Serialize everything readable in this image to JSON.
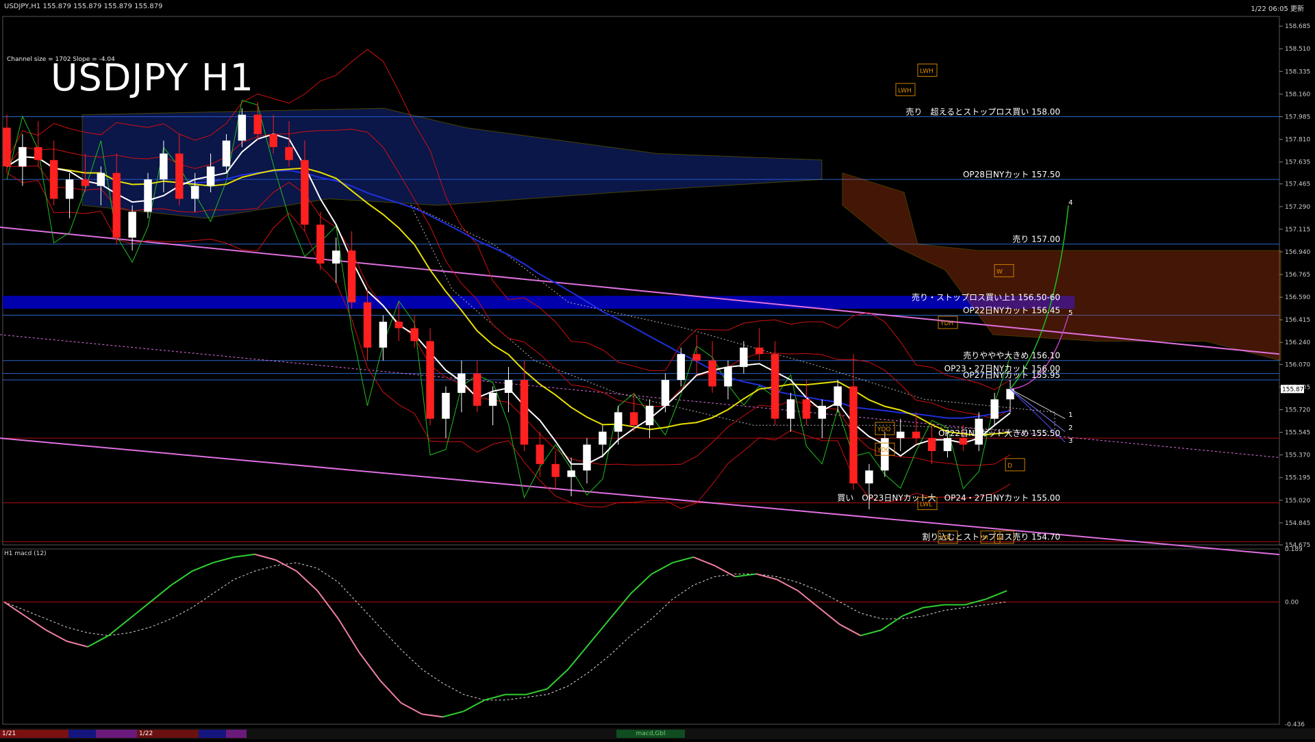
{
  "header": {
    "symbol_line": "USDJPY,H1 155.879 155.879 155.879 155.879",
    "datetime": "1/22 06:05 更新",
    "big_title": "USDJPY H1",
    "channel_info": "Channel size = 1702 Slope = -4.04",
    "macd_label": "H1 macd (12)"
  },
  "colors": {
    "background": "#000000",
    "grid_blue": "#2a66c8",
    "level_red": "#b01010",
    "band_blue": "#0000c0",
    "channel_pink": "#e070e0",
    "ma_white": "#ffffff",
    "ma_yellow": "#e8e000",
    "ma_blue": "#2030e0",
    "bollinger_red": "#d01010",
    "rsi_green": "#20c020",
    "cloud_orange": "#c04010",
    "cloud_blue": "#2040d0",
    "macd_green": "#30d030",
    "macd_pink": "#f080a0",
    "candle_up": "#ffffff",
    "candle_down": "#ff2020"
  },
  "chart_data": {
    "type": "candlestick",
    "symbol": "USDJPY",
    "timeframe": "H1",
    "current_price": "155.879",
    "ylim": [
      154.675,
      158.76
    ],
    "y_ticks": [
      "158.685",
      "158.510",
      "158.335",
      "158.160",
      "157.985",
      "157.810",
      "157.635",
      "157.465",
      "157.290",
      "157.115",
      "156.940",
      "156.765",
      "156.590",
      "156.415",
      "156.240",
      "156.070",
      "155.895",
      "155.720",
      "155.545",
      "155.370",
      "155.195",
      "155.020",
      "154.845",
      "154.675"
    ],
    "x_tick_labels": [
      "1/21",
      "1/22"
    ],
    "horizontal_levels": [
      {
        "price": 157.985,
        "label": "売り　超えるとストップロス買い 158.00",
        "color": "blue"
      },
      {
        "price": 157.5,
        "label": "OP28日NYカット 157.50",
        "color": "blue"
      },
      {
        "price": 157.0,
        "label": "売り 157.00",
        "color": "blue"
      },
      {
        "price": 156.55,
        "label": "売り・ストップロス買い上1 156.50-60",
        "color": "band"
      },
      {
        "price": 156.45,
        "label": "OP22日NYカット 156.45",
        "color": "blue"
      },
      {
        "price": 156.1,
        "label": "売りややや大きめ 156.10",
        "color": "blue"
      },
      {
        "price": 156.0,
        "label": "OP23・27日NYカット 156.00",
        "color": "blue"
      },
      {
        "price": 155.95,
        "label": "OP27日NYカット 155.95",
        "color": "blue"
      },
      {
        "price": 155.5,
        "label": "OP22日NYカット大きめ 155.50",
        "color": "red"
      },
      {
        "price": 155.0,
        "label": "買い　OP23日NYカット大　OP24・27日NYカット 155.00",
        "color": "red"
      },
      {
        "price": 154.7,
        "label": "割り込むとストップロス売り 154.70",
        "color": "red"
      }
    ],
    "box_labels": [
      "LWH",
      "LWH",
      "YDH",
      "W",
      "YDO",
      "YDC",
      "D",
      "LWL",
      "YDL",
      "M",
      "W"
    ],
    "projection_labels": [
      "1",
      "2",
      "3",
      "4",
      "5"
    ],
    "candles": [
      [
        157.9,
        158.0,
        157.55,
        157.6
      ],
      [
        157.6,
        157.85,
        157.45,
        157.75
      ],
      [
        157.75,
        157.95,
        157.6,
        157.65
      ],
      [
        157.65,
        157.8,
        157.3,
        157.35
      ],
      [
        157.35,
        157.55,
        157.2,
        157.5
      ],
      [
        157.5,
        157.7,
        157.4,
        157.45
      ],
      [
        157.45,
        157.6,
        157.3,
        157.55
      ],
      [
        157.55,
        157.7,
        157.0,
        157.05
      ],
      [
        157.05,
        157.3,
        156.95,
        157.25
      ],
      [
        157.25,
        157.55,
        157.2,
        157.5
      ],
      [
        157.5,
        157.8,
        157.4,
        157.7
      ],
      [
        157.7,
        157.85,
        157.3,
        157.35
      ],
      [
        157.35,
        157.55,
        157.25,
        157.45
      ],
      [
        157.45,
        157.7,
        157.4,
        157.6
      ],
      [
        157.6,
        157.85,
        157.55,
        157.8
      ],
      [
        157.8,
        158.05,
        157.75,
        158.0
      ],
      [
        158.0,
        158.1,
        157.8,
        157.85
      ],
      [
        157.85,
        158.0,
        157.7,
        157.75
      ],
      [
        157.75,
        157.95,
        157.6,
        157.65
      ],
      [
        157.65,
        157.8,
        157.1,
        157.15
      ],
      [
        157.15,
        157.25,
        156.8,
        156.85
      ],
      [
        156.85,
        157.05,
        156.7,
        156.95
      ],
      [
        156.95,
        157.1,
        156.5,
        156.55
      ],
      [
        156.55,
        156.65,
        156.1,
        156.2
      ],
      [
        156.2,
        156.45,
        156.1,
        156.4
      ],
      [
        156.4,
        156.55,
        156.25,
        156.35
      ],
      [
        156.35,
        156.45,
        156.2,
        156.25
      ],
      [
        156.25,
        156.35,
        155.6,
        155.65
      ],
      [
        155.65,
        155.9,
        155.5,
        155.85
      ],
      [
        155.85,
        156.1,
        155.7,
        156.0
      ],
      [
        156.0,
        156.1,
        155.7,
        155.75
      ],
      [
        155.75,
        155.9,
        155.6,
        155.85
      ],
      [
        155.85,
        156.05,
        155.7,
        155.95
      ],
      [
        155.95,
        156.1,
        155.4,
        155.45
      ],
      [
        155.45,
        155.55,
        155.2,
        155.3
      ],
      [
        155.3,
        155.4,
        155.1,
        155.2
      ],
      [
        155.2,
        155.35,
        155.05,
        155.25
      ],
      [
        155.25,
        155.5,
        155.15,
        155.45
      ],
      [
        155.45,
        155.6,
        155.35,
        155.55
      ],
      [
        155.55,
        155.75,
        155.45,
        155.7
      ],
      [
        155.7,
        155.85,
        155.55,
        155.6
      ],
      [
        155.6,
        155.8,
        155.5,
        155.75
      ],
      [
        155.75,
        156.0,
        155.7,
        155.95
      ],
      [
        155.95,
        156.2,
        155.9,
        156.15
      ],
      [
        156.15,
        156.3,
        156.0,
        156.1
      ],
      [
        156.1,
        156.25,
        155.85,
        155.9
      ],
      [
        155.9,
        156.1,
        155.8,
        156.05
      ],
      [
        156.05,
        156.25,
        156.0,
        156.2
      ],
      [
        156.2,
        156.35,
        156.1,
        156.15
      ],
      [
        156.15,
        156.25,
        155.6,
        155.65
      ],
      [
        155.65,
        155.85,
        155.55,
        155.8
      ],
      [
        155.8,
        155.95,
        155.6,
        155.65
      ],
      [
        155.65,
        155.8,
        155.5,
        155.75
      ],
      [
        155.75,
        155.95,
        155.7,
        155.9
      ],
      [
        155.9,
        156.15,
        155.1,
        155.15
      ],
      [
        155.15,
        155.3,
        154.95,
        155.25
      ],
      [
        155.25,
        155.55,
        155.2,
        155.5
      ],
      [
        155.5,
        155.65,
        155.4,
        155.55
      ],
      [
        155.55,
        155.7,
        155.45,
        155.5
      ],
      [
        155.5,
        155.6,
        155.3,
        155.4
      ],
      [
        155.4,
        155.55,
        155.35,
        155.5
      ],
      [
        155.5,
        155.6,
        155.4,
        155.45
      ],
      [
        155.45,
        155.7,
        155.4,
        155.65
      ],
      [
        155.65,
        155.85,
        155.6,
        155.8
      ],
      [
        155.8,
        155.95,
        155.7,
        155.88
      ]
    ],
    "overlays": [
      "white MA",
      "yellow MA",
      "blue MA",
      "red Bollinger bands",
      "green RSI line",
      "Ichimoku cloud",
      "pink regression channel"
    ],
    "macd": {
      "ylim": [
        -0.436,
        0.189
      ],
      "y_ticks": [
        "0.189",
        "0.00",
        "-0.436"
      ],
      "main": [
        0.0,
        -0.05,
        -0.1,
        -0.14,
        -0.16,
        -0.12,
        -0.06,
        0.0,
        0.06,
        0.11,
        0.14,
        0.16,
        0.17,
        0.15,
        0.11,
        0.04,
        -0.06,
        -0.18,
        -0.28,
        -0.36,
        -0.4,
        -0.41,
        -0.39,
        -0.35,
        -0.33,
        -0.33,
        -0.31,
        -0.24,
        -0.15,
        -0.06,
        0.03,
        0.1,
        0.14,
        0.16,
        0.13,
        0.09,
        0.1,
        0.08,
        0.04,
        -0.02,
        -0.08,
        -0.12,
        -0.1,
        -0.05,
        -0.02,
        -0.01,
        -0.01,
        0.01,
        0.04
      ],
      "signal": [
        0.0,
        -0.03,
        -0.06,
        -0.09,
        -0.11,
        -0.12,
        -0.11,
        -0.09,
        -0.06,
        -0.02,
        0.03,
        0.08,
        0.11,
        0.13,
        0.14,
        0.12,
        0.07,
        -0.01,
        -0.09,
        -0.17,
        -0.24,
        -0.29,
        -0.33,
        -0.35,
        -0.35,
        -0.34,
        -0.33,
        -0.3,
        -0.25,
        -0.19,
        -0.12,
        -0.06,
        0.01,
        0.06,
        0.09,
        0.1,
        0.1,
        0.09,
        0.07,
        0.04,
        0.0,
        -0.04,
        -0.06,
        -0.06,
        -0.05,
        -0.03,
        -0.02,
        -0.01,
        0.0
      ]
    }
  },
  "tabs": {
    "label_1": "1/21",
    "label_2": "1/22",
    "chart_tab": "macd,Gbl"
  }
}
